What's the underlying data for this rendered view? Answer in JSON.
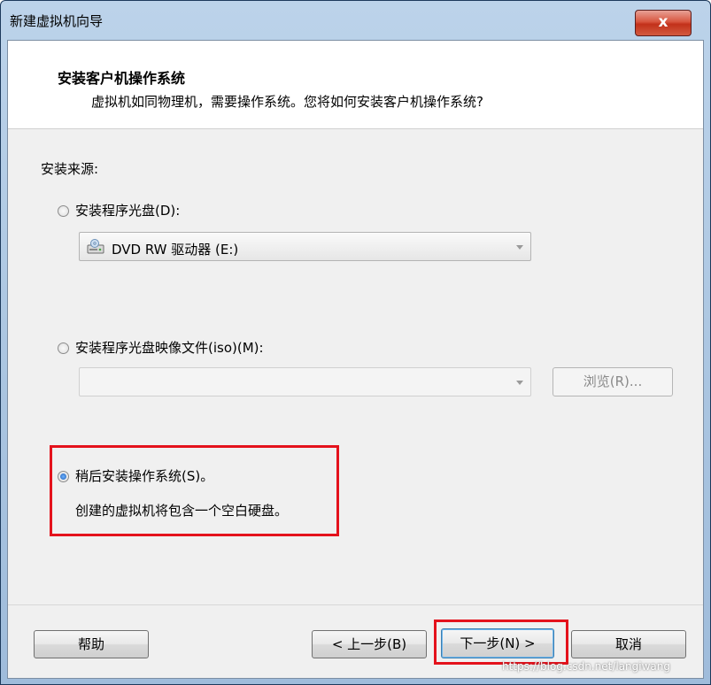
{
  "window": {
    "title": "新建虚拟机向导",
    "close_glyph": "x"
  },
  "header": {
    "title": "安装客户机操作系统",
    "subtitle": "虚拟机如同物理机，需要操作系统。您将如何安装客户机操作系统?"
  },
  "install_source_label": "安装来源:",
  "options": {
    "disc": {
      "label": "安装程序光盘(D):",
      "selected": false,
      "drive_value": "DVD RW 驱动器 (E:)",
      "drive_icon": "optical-drive-icon"
    },
    "iso": {
      "label": "安装程序光盘映像文件(iso)(M):",
      "selected": false,
      "path_value": "",
      "browse_label": "浏览(R)..."
    },
    "later": {
      "label": "稍后安装操作系统(S)。",
      "selected": true,
      "description": "创建的虚拟机将包含一个空白硬盘。"
    }
  },
  "footer": {
    "help_label": "帮助",
    "back_label": "< 上一步(B)",
    "next_label": "下一步(N) >",
    "cancel_label": "取消"
  },
  "watermark": "https://blog.csdn.net/langiwang",
  "colors": {
    "highlight": "#e4121c",
    "radio_selected": "#1e5fb5"
  }
}
